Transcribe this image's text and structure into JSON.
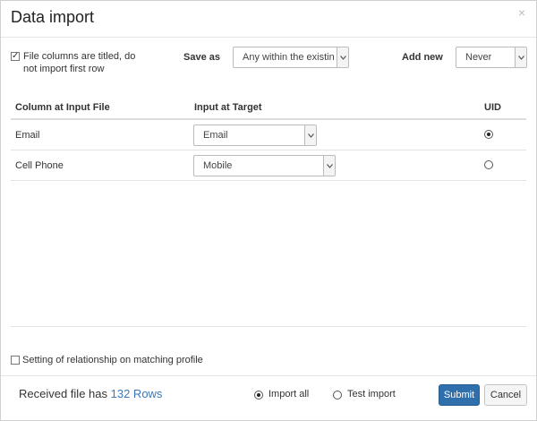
{
  "dialog": {
    "title": "Data import",
    "close_glyph": "×"
  },
  "options": {
    "titled_checkbox": {
      "checked": true,
      "mark": "✓",
      "label_line1": "File columns are titled, do",
      "label_line2": "not import first row"
    },
    "save_as": {
      "label": "Save as",
      "value": "Any within the existing p"
    },
    "add_new": {
      "label": "Add new",
      "value": "Never"
    }
  },
  "table": {
    "headers": {
      "column_at_input": "Column at Input File",
      "input_at_target": "Input at Target",
      "uid": "UID"
    },
    "rows": [
      {
        "column": "Email",
        "target": "Email",
        "uid_selected": true
      },
      {
        "column": "Cell Phone",
        "target": "Mobile",
        "uid_selected": false
      }
    ]
  },
  "relationship": {
    "checked": false,
    "label": "Setting of relationship on matching profile"
  },
  "footer": {
    "received_prefix": "Received file has",
    "rows_count": "132 Rows",
    "import_all": {
      "label": "Import all",
      "selected": true
    },
    "test_import": {
      "label": "Test import",
      "selected": false
    },
    "submit_label": "Submit",
    "cancel_label": "Cancel"
  },
  "colors": {
    "primary": "#2f6fab",
    "link": "#3a78b8"
  }
}
